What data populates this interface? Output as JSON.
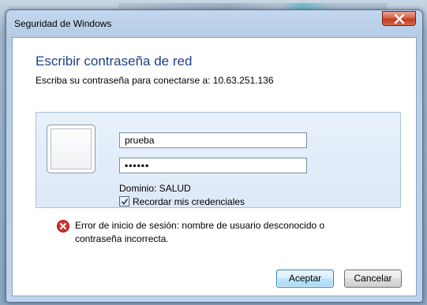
{
  "window": {
    "title": "Seguridad de Windows"
  },
  "dialog": {
    "heading": "Escribir contraseña de red",
    "subheading": "Escriba su contraseña para conectarse a: 10.63.251.136"
  },
  "credentials": {
    "username_value": "prueba",
    "password_value": "••••••",
    "domain_text": "Dominio: SALUD",
    "remember_label": "Recordar mis credenciales",
    "remember_checked": true
  },
  "error": {
    "icon": "error-x-icon",
    "message_line1": "Error de inicio de sesión: nombre de usuario desconocido o",
    "message_line2": "contraseña incorrecta."
  },
  "buttons": {
    "ok_label": "Aceptar",
    "cancel_label": "Cancelar"
  },
  "colors": {
    "heading": "#1e3f8a",
    "close_button": "#c23a20",
    "error_icon": "#d2312b"
  }
}
